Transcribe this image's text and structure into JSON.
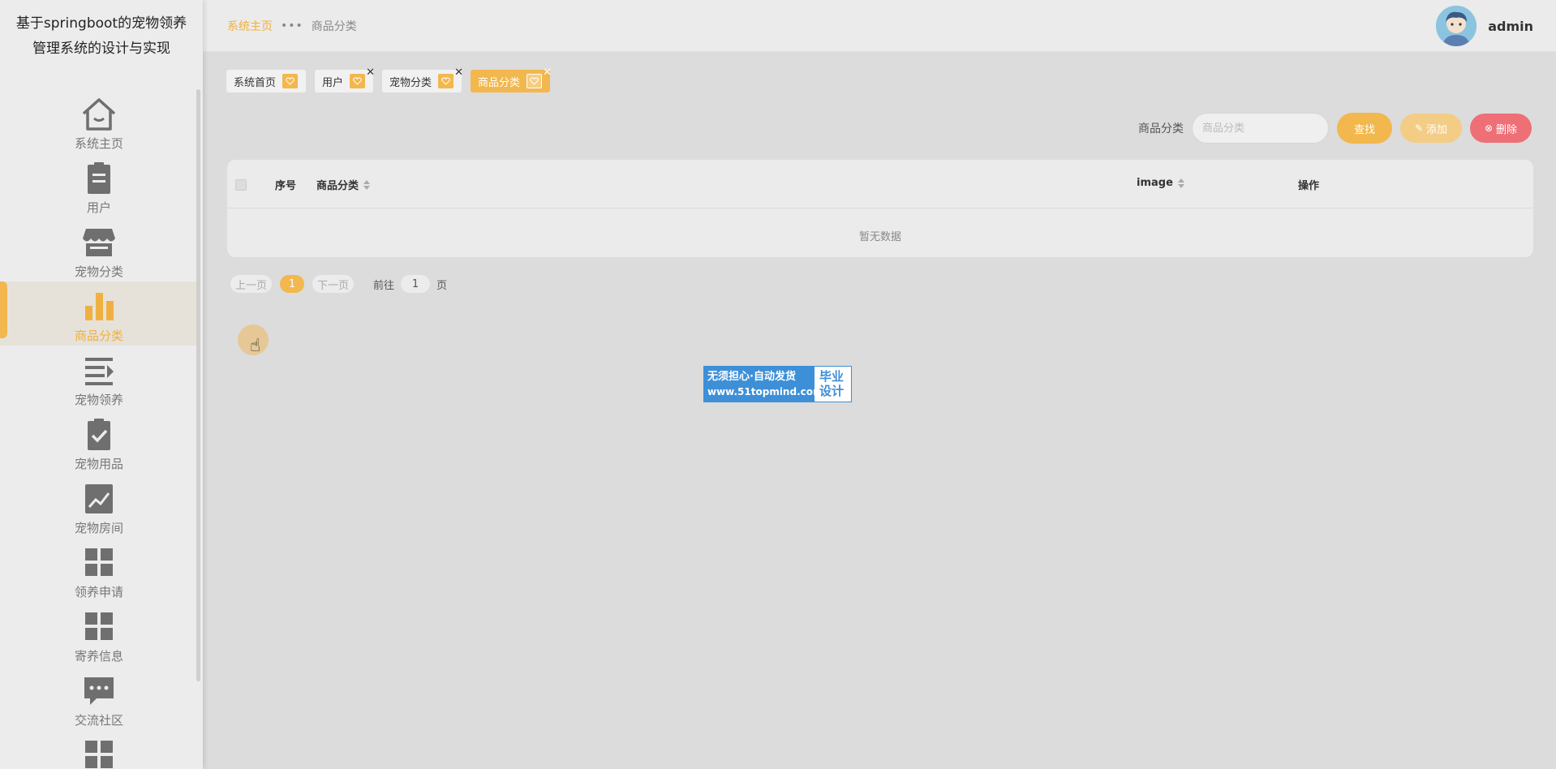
{
  "sidebar": {
    "title": "基于springboot的宠物领养管理系统的设计与实现",
    "items": [
      {
        "label": "系统主页",
        "icon": "home-icon"
      },
      {
        "label": "用户",
        "icon": "clipboard-icon"
      },
      {
        "label": "宠物分类",
        "icon": "store-icon"
      },
      {
        "label": "商品分类",
        "icon": "bar-chart-icon",
        "active": true
      },
      {
        "label": "宠物领养",
        "icon": "list-arrow-icon"
      },
      {
        "label": "宠物用品",
        "icon": "clipboard-check-icon"
      },
      {
        "label": "宠物房间",
        "icon": "line-chart-icon"
      },
      {
        "label": "领养申请",
        "icon": "grid-icon"
      },
      {
        "label": "寄养信息",
        "icon": "grid-icon"
      },
      {
        "label": "交流社区",
        "icon": "chat-icon"
      },
      {
        "label": "",
        "icon": "grid-icon"
      }
    ]
  },
  "header": {
    "breadcrumb_home": "系统主页",
    "breadcrumb_current": "商品分类",
    "username": "admin"
  },
  "tags": [
    {
      "label": "系统首页",
      "closable": false
    },
    {
      "label": "用户",
      "closable": true
    },
    {
      "label": "宠物分类",
      "closable": true
    },
    {
      "label": "商品分类",
      "closable": true,
      "active": true
    }
  ],
  "search": {
    "label": "商品分类",
    "placeholder": "商品分类",
    "find_label": "查找",
    "add_label": "添加",
    "delete_label": "删除"
  },
  "table": {
    "col_index": "序号",
    "col_category": "商品分类",
    "col_image": "image",
    "col_actions": "操作",
    "empty_text": "暂无数据"
  },
  "pager": {
    "prev": "上一页",
    "current": "1",
    "next": "下一页",
    "goto_label": "前往",
    "goto_value": "1",
    "unit": "页"
  },
  "watermark": {
    "line1": "无须担心·自动发货",
    "line2": "www.51topmind.com",
    "side": "毕业设计"
  },
  "colors": {
    "accent": "#f2b74d",
    "danger": "#ee6f76",
    "icon_gray": "#6f6f6f"
  }
}
